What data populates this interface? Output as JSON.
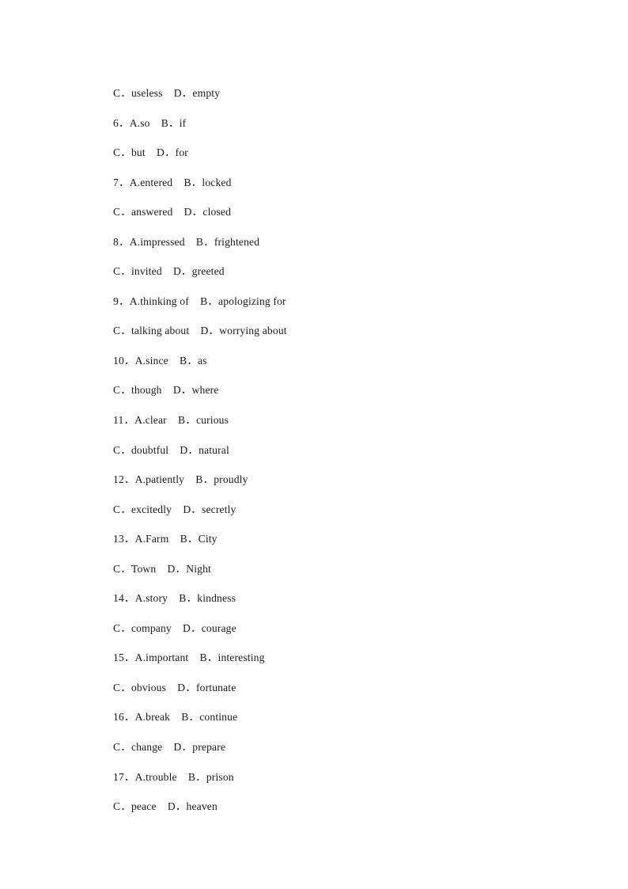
{
  "document": {
    "page_background": "#ffffff",
    "text_color": "#1a1a1a",
    "type": "cloze-test-options",
    "lines": [
      {
        "id": "line-1",
        "kind": "continuation",
        "text": "C．useless    D．empty"
      },
      {
        "id": "line-2",
        "kind": "question",
        "text": "6．A.so    B．if"
      },
      {
        "id": "line-3",
        "kind": "continuation",
        "text": "C．but    D．for"
      },
      {
        "id": "line-4",
        "kind": "question",
        "text": "7．A.entered    B．locked"
      },
      {
        "id": "line-5",
        "kind": "continuation",
        "text": "C．answered    D．closed"
      },
      {
        "id": "line-6",
        "kind": "question",
        "text": "8．A.impressed    B．frightened"
      },
      {
        "id": "line-7",
        "kind": "continuation",
        "text": "C．invited    D．greeted"
      },
      {
        "id": "line-8",
        "kind": "question",
        "text": "9．A.thinking of    B．apologizing for"
      },
      {
        "id": "line-9",
        "kind": "continuation",
        "text": "C．talking about    D．worrying about"
      },
      {
        "id": "line-10",
        "kind": "question",
        "text": "10．A.since    B．as"
      },
      {
        "id": "line-11",
        "kind": "continuation",
        "text": "C．though    D．where"
      },
      {
        "id": "line-12",
        "kind": "question",
        "text": "11．A.clear    B．curious"
      },
      {
        "id": "line-13",
        "kind": "continuation",
        "text": "C．doubtful    D．natural"
      },
      {
        "id": "line-14",
        "kind": "question",
        "text": "12．A.patiently    B．proudly"
      },
      {
        "id": "line-15",
        "kind": "continuation",
        "text": "C．excitedly    D．secretly"
      },
      {
        "id": "line-16",
        "kind": "question",
        "text": "13．A.Farm    B．City"
      },
      {
        "id": "line-17",
        "kind": "continuation",
        "text": "C．Town    D．Night"
      },
      {
        "id": "line-18",
        "kind": "question",
        "text": "14．A.story    B．kindness"
      },
      {
        "id": "line-19",
        "kind": "continuation",
        "text": "C．company    D．courage"
      },
      {
        "id": "line-20",
        "kind": "question",
        "text": "15．A.important    B．interesting"
      },
      {
        "id": "line-21",
        "kind": "continuation",
        "text": "C．obvious    D．fortunate"
      },
      {
        "id": "line-22",
        "kind": "question",
        "text": "16．A.break    B．continue"
      },
      {
        "id": "line-23",
        "kind": "continuation",
        "text": "C．change    D．prepare"
      },
      {
        "id": "line-24",
        "kind": "question",
        "text": "17．A.trouble    B．prison"
      },
      {
        "id": "line-25",
        "kind": "continuation",
        "text": "C．peace    D．heaven"
      }
    ],
    "questions": [
      {
        "number": "6",
        "options": {
          "A": "so",
          "B": "if",
          "C": "but",
          "D": "for"
        }
      },
      {
        "number": "7",
        "options": {
          "A": "entered",
          "B": "locked",
          "C": "answered",
          "D": "closed"
        }
      },
      {
        "number": "8",
        "options": {
          "A": "impressed",
          "B": "frightened",
          "C": "invited",
          "D": "greeted"
        }
      },
      {
        "number": "9",
        "options": {
          "A": "thinking of",
          "B": "apologizing for",
          "C": "talking about",
          "D": "worrying about"
        }
      },
      {
        "number": "10",
        "options": {
          "A": "since",
          "B": "as",
          "C": "though",
          "D": "where"
        }
      },
      {
        "number": "11",
        "options": {
          "A": "clear",
          "B": "curious",
          "C": "doubtful",
          "D": "natural"
        }
      },
      {
        "number": "12",
        "options": {
          "A": "patiently",
          "B": "proudly",
          "C": "excitedly",
          "D": "secretly"
        }
      },
      {
        "number": "13",
        "options": {
          "A": "Farm",
          "B": "City",
          "C": "Town",
          "D": "Night"
        }
      },
      {
        "number": "14",
        "options": {
          "A": "story",
          "B": "kindness",
          "C": "company",
          "D": "courage"
        }
      },
      {
        "number": "15",
        "options": {
          "A": "important",
          "B": "interesting",
          "C": "obvious",
          "D": "fortunate"
        }
      },
      {
        "number": "16",
        "options": {
          "A": "break",
          "B": "continue",
          "C": "change",
          "D": "prepare"
        }
      },
      {
        "number": "17",
        "options": {
          "A": "trouble",
          "B": "prison",
          "C": "peace",
          "D": "heaven"
        }
      }
    ],
    "partial_question_top": {
      "C": "useless",
      "D": "empty"
    }
  }
}
